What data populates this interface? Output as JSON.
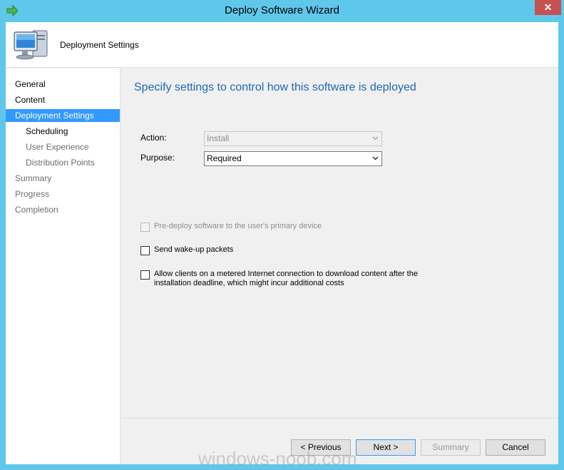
{
  "window": {
    "title": "Deploy Software Wizard",
    "close_label": "✕",
    "accent_color": "#5fc7ea",
    "app_icon": "green-arrow-icon"
  },
  "header": {
    "title": "Deployment Settings",
    "icon": "computer-monitor-icon"
  },
  "nav": {
    "items": [
      {
        "label": "General",
        "state": "normal"
      },
      {
        "label": "Content",
        "state": "normal"
      },
      {
        "label": "Deployment Settings",
        "state": "active"
      },
      {
        "label": "Scheduling",
        "state": "normal"
      },
      {
        "label": "User Experience",
        "state": "muted"
      },
      {
        "label": "Distribution Points",
        "state": "muted"
      },
      {
        "label": "Summary",
        "state": "muted"
      },
      {
        "label": "Progress",
        "state": "muted"
      },
      {
        "label": "Completion",
        "state": "muted"
      }
    ]
  },
  "content": {
    "heading": "Specify settings to control how this software is deployed",
    "action": {
      "label": "Action:",
      "value": "Install"
    },
    "purpose": {
      "label": "Purpose:",
      "value": "Required"
    },
    "predeploy": {
      "label": "Pre-deploy software to the user's primary device",
      "checked": false
    },
    "wakeup": {
      "label": "Send wake-up packets",
      "checked": false
    },
    "metered": {
      "label_line1": "Allow clients on a metered Internet connection to download content after the",
      "label_line2": "installation deadline, which might incur additional costs",
      "checked": false
    }
  },
  "buttons": {
    "previous": "< Previous",
    "next": "Next >",
    "summary": "Summary",
    "cancel": "Cancel"
  },
  "watermark": "windows-noob.com"
}
